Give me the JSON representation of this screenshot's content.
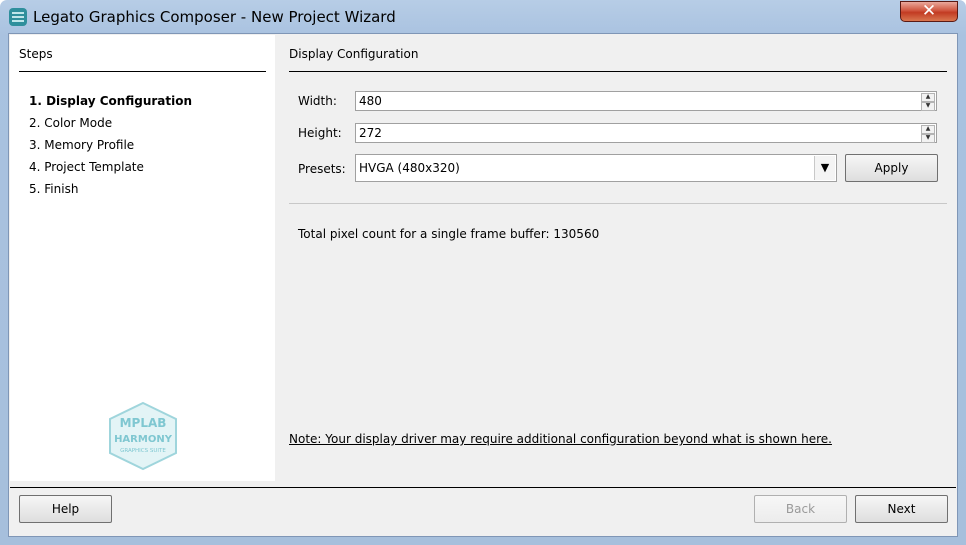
{
  "window": {
    "title": "Legato Graphics Composer - New Project Wizard",
    "close_glyph": "✕",
    "accent": "#c23b22"
  },
  "steps": {
    "title": "Steps",
    "items": [
      {
        "label": "1.  Display Configuration",
        "active": true
      },
      {
        "label": "2.  Color Mode",
        "active": false
      },
      {
        "label": "3.  Memory Profile",
        "active": false
      },
      {
        "label": "4.  Project Template",
        "active": false
      },
      {
        "label": "5.  Finish",
        "active": false
      }
    ],
    "logo": {
      "line1": "MPLAB",
      "line2": "HARMONY",
      "line3": "GRAPHICS SUITE"
    }
  },
  "display": {
    "section_title": "Display Configuration",
    "width_label": "Width:",
    "width_value": "480",
    "height_label": "Height:",
    "height_value": "272",
    "presets_label": "Presets:",
    "preset_value": "HVGA (480x320)",
    "apply_label": "Apply",
    "pixel_count_text": "Total pixel count for a single frame buffer:  130560",
    "note": "Note: Your display driver may require additional configuration beyond what is shown here."
  },
  "footer": {
    "help_label": "Help",
    "back_label": "Back",
    "next_label": "Next"
  }
}
